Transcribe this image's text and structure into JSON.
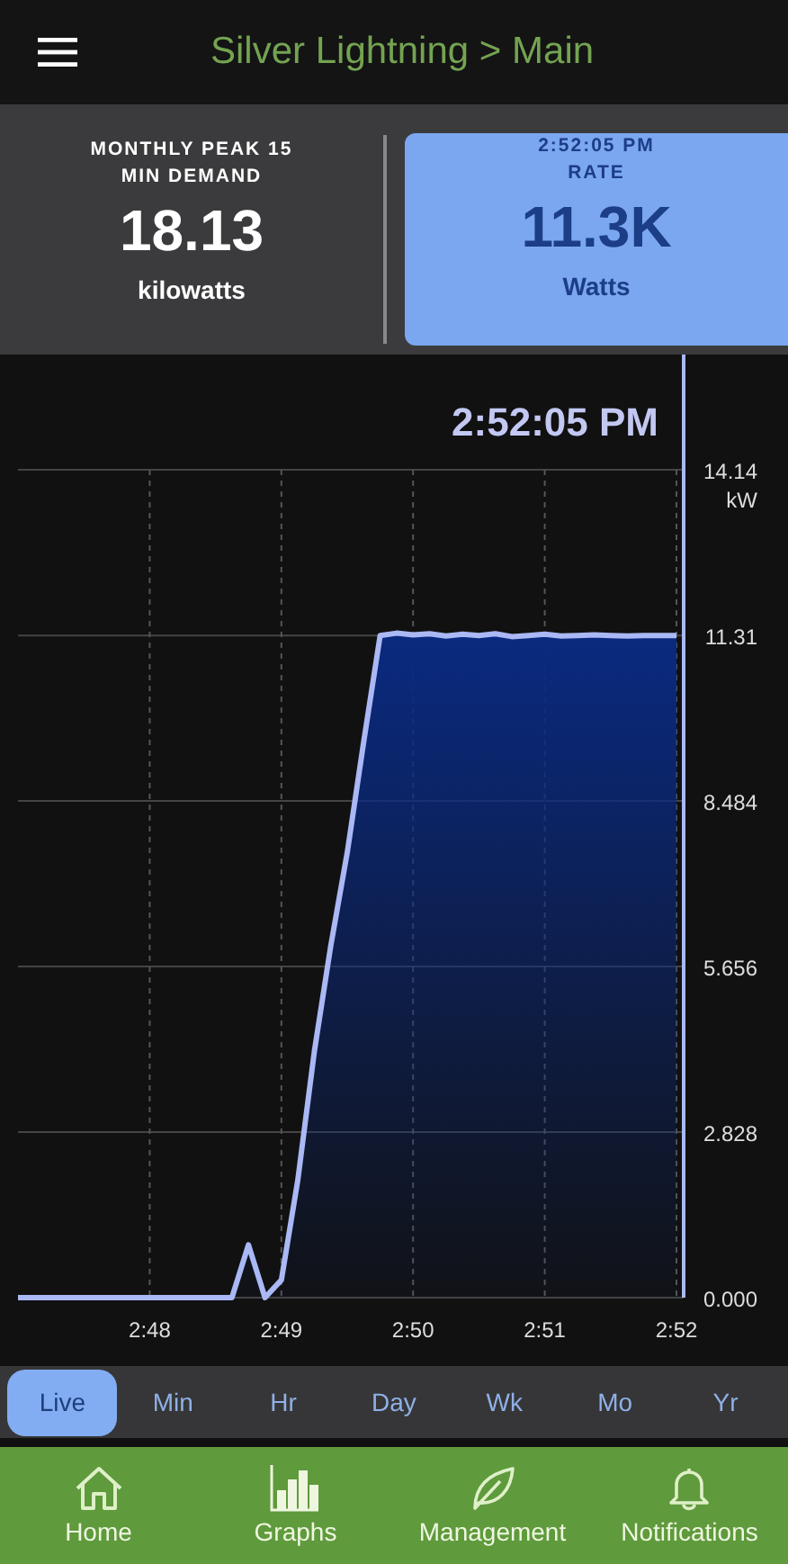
{
  "header": {
    "title": "Silver Lightning > Main"
  },
  "summary": [
    {
      "kind": "stat",
      "caption_lines": [
        "MONTHLY PEAK 15",
        "MIN DEMAND"
      ],
      "value": "18.13",
      "unit": "kilowatts",
      "selected": false
    },
    {
      "kind": "stat",
      "caption_lines": [
        "2:52:05 PM",
        "RATE"
      ],
      "value": "11.3K",
      "unit": "Watts",
      "selected": true
    }
  ],
  "chart": {
    "cursor_time": "2:52:05 PM",
    "chart_data": {
      "type": "area",
      "ylabel": "kW",
      "ylim": [
        0,
        14.14
      ],
      "grid": true,
      "categories": [
        null,
        null,
        null,
        null,
        null,
        null,
        null,
        null,
        "2:48",
        null,
        null,
        null,
        null,
        null,
        null,
        null,
        "2:49",
        null,
        null,
        null,
        null,
        null,
        null,
        null,
        "2:50",
        null,
        null,
        null,
        null,
        null,
        null,
        null,
        "2:51",
        null,
        null,
        null,
        null,
        null,
        null,
        null,
        "2:52"
      ],
      "yticks": [
        {
          "value": 0,
          "label": "0.000"
        },
        {
          "value": 2.828,
          "label": "2.828"
        },
        {
          "value": 5.656,
          "label": "5.656"
        },
        {
          "value": 8.484,
          "label": "8.484"
        },
        {
          "value": 11.31,
          "label": "11.31"
        },
        {
          "value": 14.14,
          "label": "14.14"
        }
      ],
      "series": [
        {
          "color": "#aab8f5",
          "values": [
            0,
            0,
            0,
            0,
            0,
            0,
            0,
            0,
            0,
            0,
            0,
            0,
            0,
            0,
            0.9,
            0,
            0.3,
            2.0,
            4.2,
            6.0,
            7.6,
            9.5,
            11.31,
            11.35,
            11.32,
            11.34,
            11.3,
            11.33,
            11.31,
            11.34,
            11.29,
            11.31,
            11.33,
            11.3,
            11.31,
            11.32,
            11.31,
            11.3,
            11.31,
            11.31,
            11.31
          ]
        }
      ]
    }
  },
  "ranges": [
    {
      "label": "Live",
      "selected": true
    },
    {
      "label": "Min",
      "selected": false
    },
    {
      "label": "Hr",
      "selected": false
    },
    {
      "label": "Day",
      "selected": false
    },
    {
      "label": "Wk",
      "selected": false
    },
    {
      "label": "Mo",
      "selected": false
    },
    {
      "label": "Yr",
      "selected": false
    }
  ],
  "nav": [
    {
      "kind": "home",
      "label": "Home"
    },
    {
      "kind": "graphs",
      "label": "Graphs"
    },
    {
      "kind": "leaf",
      "label": "Management"
    },
    {
      "kind": "bell",
      "label": "Notifications"
    }
  ]
}
